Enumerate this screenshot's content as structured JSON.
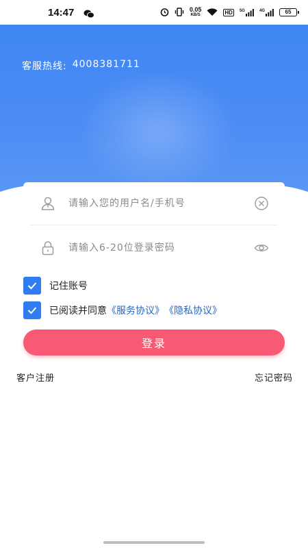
{
  "status_bar": {
    "time": "14:47",
    "net_speed": "0.05",
    "net_unit": "KB/S",
    "hd_label": "HD",
    "sig1_label": "5G",
    "sig2_label": "4G",
    "battery": "65"
  },
  "header": {
    "hotline_label": "客服热线:",
    "hotline_number": "4008381711",
    "color": "#4488f4"
  },
  "form": {
    "username_placeholder": "请输入您的用户名/手机号",
    "password_placeholder": "请输入6-20位登录密码",
    "remember_label": "记住账号",
    "agree_text": "已阅读并同意",
    "service_agreement": "《服务协议》",
    "privacy_agreement": "《隐私协议》",
    "login_label": "登录"
  },
  "links": {
    "register": "客户注册",
    "forgot_password": "忘记密码"
  },
  "colors": {
    "primary_blue": "#2f7df1",
    "login_button": "#f75a72",
    "link": "#2266c6"
  }
}
